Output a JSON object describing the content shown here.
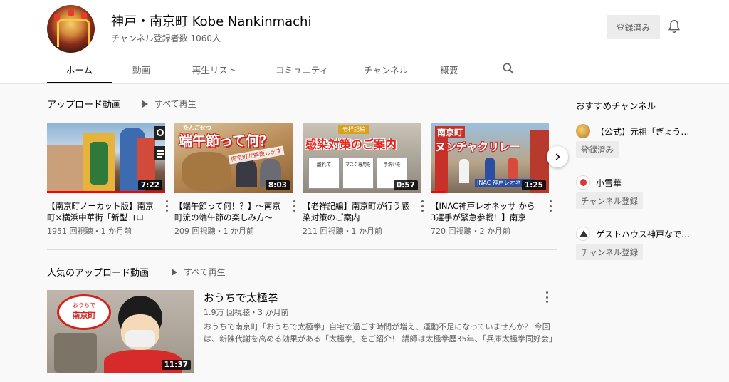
{
  "channel": {
    "title": "神戸・南京町 Kobe Nankinmachi",
    "subscribers": "チャンネル登録者数 1060人",
    "subscribed_label": "登録済み"
  },
  "tabs": [
    {
      "label": "ホーム",
      "active": true
    },
    {
      "label": "動画"
    },
    {
      "label": "再生リスト"
    },
    {
      "label": "コミュニティ"
    },
    {
      "label": "チャンネル"
    },
    {
      "label": "概要"
    }
  ],
  "uploads": {
    "title": "アップロード動画",
    "play_all": "すべて再生",
    "videos": [
      {
        "title": "【南京町ノーカット版】南京町×横浜中華街「新型コロナ…",
        "meta": "1951 回視聴・1 か月前",
        "duration": "7:22"
      },
      {
        "title": "【端午節って何！？】〜南京町流の端午節の楽しみ方〜",
        "meta": "209 回視聴・1 か月前",
        "duration": "8:03"
      },
      {
        "title": "【老祥記編】南京町が行う感染対策のご案内",
        "meta": "211 回視聴・1 か月前",
        "duration": "0:57"
      },
      {
        "title": "【INAC神戸レオネッサ から3選手が緊急参戦！】南京町…",
        "meta": "720 回視聴・2 か月前",
        "duration": "1:25"
      }
    ],
    "thumb_text": {
      "v2_ruby": "たんごせつ",
      "v2_main": "端午節って何？",
      "v2_sub": "南京町が解説します",
      "v3_top": "老祥記編",
      "v3_main": "感染対策のご案内",
      "v3_p1": "離れて",
      "v3_p2": "マスク着用を",
      "v3_p3": "手洗いを",
      "v4_tag": "南京町",
      "v4_main": "ヌンチャクリレー",
      "v4_sub": "INAC 神戸レオネッサ"
    }
  },
  "popular": {
    "title": "人気のアップロード動画",
    "play_all": "すべて再生",
    "video": {
      "title": "おうちで太極拳",
      "meta": "1.9万 回視聴・3 か月前",
      "duration": "11:37",
      "description": "おうちで南京町「おうちで太極拳」自宅で過ごす時間が増え、運動不足になっていませんか？ 今回は、新陳代謝を高める効果がある「太極拳」をご紹介！ 講師は太極拳歴35年、「兵庫太極拳同好会」",
      "logo_top": "おうちで",
      "logo_main": "南京町"
    }
  },
  "recommended": {
    "title": "おすすめチャンネル",
    "channels": [
      {
        "name": "【公式】元祖「ぎょう…",
        "button": "登録済み"
      },
      {
        "name": "小雪華",
        "button": "チャンネル登録"
      },
      {
        "name": "ゲストハウス神戸なで…",
        "button": "チャンネル登録"
      }
    ]
  },
  "colors": {
    "accent_red": "#ff0000",
    "text": "#030303",
    "secondary": "#606060"
  }
}
